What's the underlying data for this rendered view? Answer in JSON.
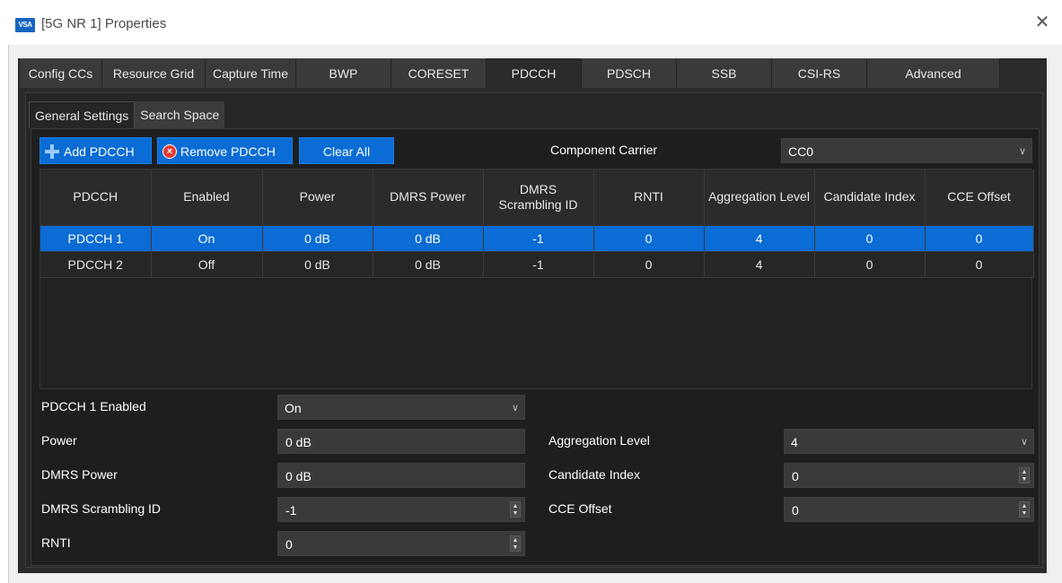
{
  "window": {
    "title": "[5G NR 1] Properties",
    "app_icon_text": "VSA",
    "close_icon": "close-icon"
  },
  "tabs": [
    {
      "label": "Config CCs"
    },
    {
      "label": "Resource Grid"
    },
    {
      "label": "Capture Time"
    },
    {
      "label": "BWP"
    },
    {
      "label": "CORESET"
    },
    {
      "label": "PDCCH",
      "active": true
    },
    {
      "label": "PDSCH"
    },
    {
      "label": "SSB"
    },
    {
      "label": "CSI-RS"
    },
    {
      "label": "Advanced"
    }
  ],
  "subtabs": [
    {
      "label": "General Settings",
      "active": true
    },
    {
      "label": "Search Space"
    }
  ],
  "toolbar": {
    "add_label": "Add PDCCH",
    "remove_label": "Remove PDCCH",
    "clear_label": "Clear All",
    "component_carrier_label": "Component Carrier",
    "component_carrier_value": "CC0"
  },
  "table": {
    "headers": [
      "PDCCH",
      "Enabled",
      "Power",
      "DMRS Power",
      "DMRS Scrambling ID",
      "RNTI",
      "Aggregation Level",
      "Candidate Index",
      "CCE Offset"
    ],
    "rows": [
      [
        "PDCCH 1",
        "On",
        "0 dB",
        "0 dB",
        "-1",
        "0",
        "4",
        "0",
        "0"
      ],
      [
        "PDCCH 2",
        "Off",
        "0 dB",
        "0 dB",
        "-1",
        "0",
        "4",
        "0",
        "0"
      ]
    ],
    "selected_row": 0
  },
  "form": {
    "enabled_label": "PDCCH 1 Enabled",
    "enabled_value": "On",
    "power_label": "Power",
    "power_value": "0 dB",
    "dmrs_power_label": "DMRS Power",
    "dmrs_power_value": "0 dB",
    "dmrs_scrambling_label": "DMRS Scrambling ID",
    "dmrs_scrambling_value": "-1",
    "rnti_label": "RNTI",
    "rnti_value": "0",
    "aggregation_label": "Aggregation Level",
    "aggregation_value": "4",
    "candidate_label": "Candidate Index",
    "candidate_value": "0",
    "cce_label": "CCE Offset",
    "cce_value": "0"
  },
  "colors": {
    "accent": "#0a6cd4",
    "background": "#1e1e1e",
    "panel": "#2b2b2b"
  }
}
